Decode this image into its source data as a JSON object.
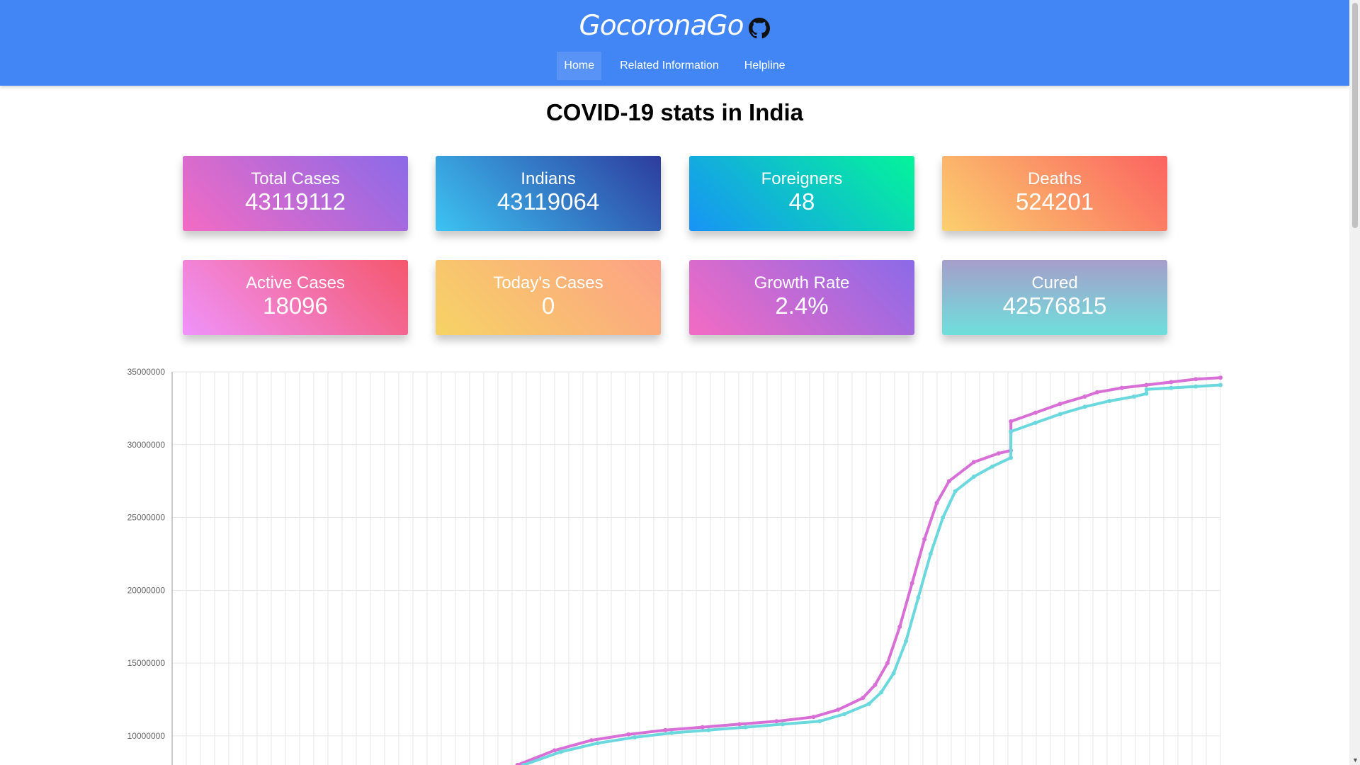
{
  "header": {
    "brand": "GocoronaGo",
    "nav": [
      {
        "label": "Home"
      },
      {
        "label": "Related Information"
      },
      {
        "label": "Helpline"
      }
    ]
  },
  "main": {
    "title": "COVID-19 stats in India",
    "cards": [
      {
        "label": "Total Cases",
        "value": "43119112"
      },
      {
        "label": "Indians",
        "value": "43119064"
      },
      {
        "label": "Foreigners",
        "value": "48"
      },
      {
        "label": "Deaths",
        "value": "524201"
      },
      {
        "label": "Active Cases",
        "value": "18096"
      },
      {
        "label": "Today's Cases",
        "value": "0"
      },
      {
        "label": "Growth Rate",
        "value": "2.4%"
      },
      {
        "label": "Cured",
        "value": "42576815"
      }
    ]
  },
  "colors": {
    "navbar": "#4285f4",
    "series_total": "#d86fd6",
    "series_cured": "#6ad8dc"
  },
  "chart_data": {
    "type": "line",
    "y_ticks": [
      "35000000",
      "30000000",
      "25000000",
      "20000000",
      "15000000",
      "10000000"
    ],
    "ylim": [
      8000000,
      35000000
    ],
    "x_index_range": [
      0,
      74
    ],
    "grid": true,
    "series": [
      {
        "points": [
          [
            28,
            8000000
          ],
          [
            31,
            9000000
          ],
          [
            34,
            9700000
          ],
          [
            37,
            10100000
          ],
          [
            40,
            10400000
          ],
          [
            43,
            10600000
          ],
          [
            46,
            10800000
          ],
          [
            49,
            11000000
          ],
          [
            52,
            11300000
          ],
          [
            54,
            11800000
          ],
          [
            56,
            12600000
          ],
          [
            57,
            13500000
          ],
          [
            58,
            15000000
          ],
          [
            59,
            17500000
          ],
          [
            60,
            20500000
          ],
          [
            61,
            23500000
          ],
          [
            62,
            26000000
          ],
          [
            63,
            27500000
          ],
          [
            65,
            28800000
          ],
          [
            67,
            29400000
          ],
          [
            68,
            29600000
          ],
          [
            68.01,
            31600000
          ],
          [
            70,
            32200000
          ],
          [
            72,
            32800000
          ],
          [
            74,
            33300000
          ],
          [
            75,
            33600000
          ],
          [
            77,
            33900000
          ],
          [
            79,
            34100000
          ],
          [
            81,
            34300000
          ],
          [
            83,
            34500000
          ],
          [
            85,
            34600000
          ]
        ]
      },
      {
        "points": [
          [
            28.5,
            8000000
          ],
          [
            31.5,
            8900000
          ],
          [
            34.5,
            9500000
          ],
          [
            37.5,
            9900000
          ],
          [
            40.5,
            10200000
          ],
          [
            43.5,
            10400000
          ],
          [
            46.5,
            10600000
          ],
          [
            49.5,
            10800000
          ],
          [
            52.5,
            11000000
          ],
          [
            54.5,
            11500000
          ],
          [
            56.5,
            12200000
          ],
          [
            57.5,
            13000000
          ],
          [
            58.5,
            14300000
          ],
          [
            59.5,
            16500000
          ],
          [
            60.5,
            19500000
          ],
          [
            61.5,
            22500000
          ],
          [
            62.5,
            25000000
          ],
          [
            63.5,
            26800000
          ],
          [
            65,
            27800000
          ],
          [
            66.5,
            28500000
          ],
          [
            68,
            29100000
          ],
          [
            68.01,
            30900000
          ],
          [
            70,
            31500000
          ],
          [
            72,
            32100000
          ],
          [
            74,
            32600000
          ],
          [
            76,
            33000000
          ],
          [
            78,
            33300000
          ],
          [
            79,
            33500000
          ],
          [
            79.01,
            33800000
          ],
          [
            81,
            33900000
          ],
          [
            83,
            34000000
          ],
          [
            85,
            34100000
          ]
        ]
      }
    ]
  }
}
